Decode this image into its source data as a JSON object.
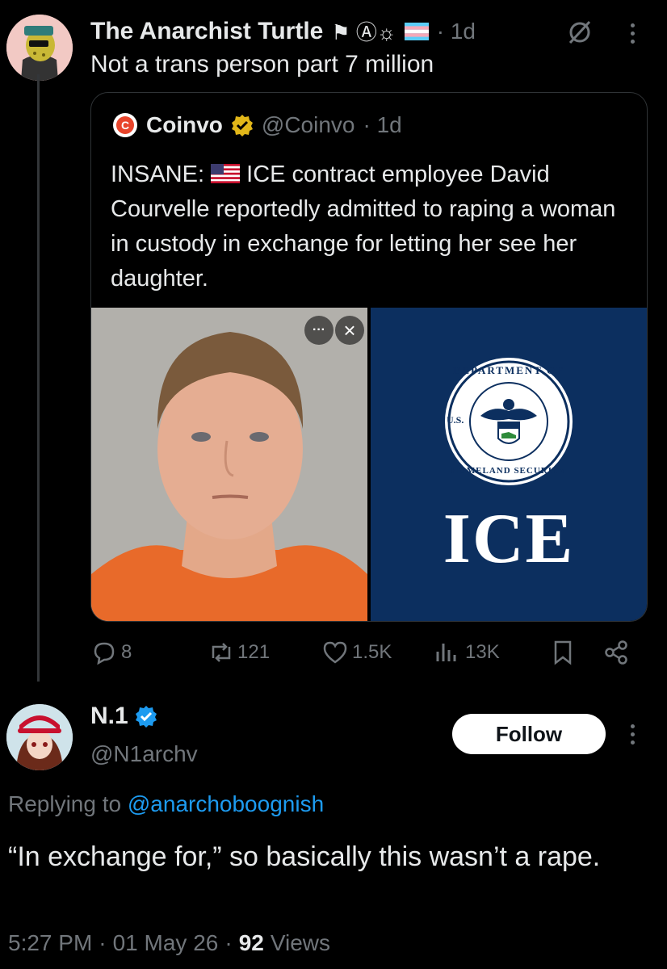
{
  "tweet": {
    "author_name": "The Anarchist Turtle",
    "name_emojis": "⚑ Ⓐ☼",
    "time": "· 1d",
    "text": "Not a trans person part 7 million",
    "quote": {
      "author_name": "Coinvo",
      "handle": "@Coinvo",
      "time": "· 1d",
      "text_prefix": "INSANE:",
      "text_rest": "ICE contract employee David Courvelle reportedly admitted to raping a woman in custody in exchange for letting her see her daughter.",
      "image_overlay_more": "···",
      "image_overlay_close": "×",
      "seal_top": "DEPARTMENT OF",
      "seal_left": "U.S.",
      "seal_bottom": "HOMELAND SECURITY",
      "ice_label": "ICE"
    },
    "actions": {
      "replies": "8",
      "reposts": "121",
      "likes": "1.5K",
      "views": "13K"
    }
  },
  "reply": {
    "author_name": "N.1",
    "handle": "@N1archv",
    "follow_label": "Follow",
    "replying_prefix": "Replying to",
    "replying_to": "@anarchoboognish",
    "text": "“In exchange for,” so basically this wasn’t a rape.",
    "time": "5:27 PM",
    "date": "01 May 26",
    "views_count": "92",
    "views_label": "Views",
    "separator": "·"
  },
  "colors": {
    "background": "#000000",
    "text": "#e7e9ea",
    "muted": "#71767b",
    "link": "#1d9bf0",
    "ice_blue": "#0c2f5f",
    "verified_gold": "#e2b719",
    "verified_blue": "#1d9bf0"
  }
}
